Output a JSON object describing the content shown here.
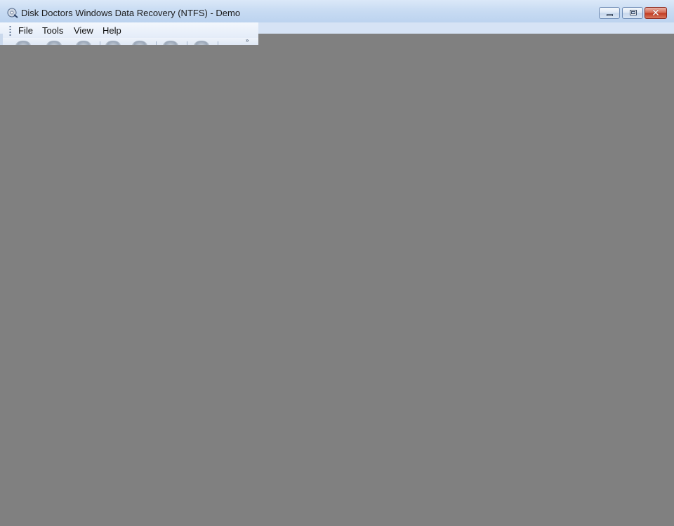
{
  "window": {
    "title": "Disk Doctors Windows Data Recovery (NTFS) - Demo",
    "app_icon": "disk-recovery-icon",
    "controls": {
      "minimize_icon": "minimize-icon",
      "maximize_icon": "restore-icon",
      "close_icon": "close-icon",
      "close_glyph": "✕"
    }
  },
  "menubar": {
    "items": [
      {
        "label": "File"
      },
      {
        "label": "Tools"
      },
      {
        "label": "View"
      },
      {
        "label": "Help"
      }
    ]
  },
  "toolbar": {
    "overflow_glyph": "»"
  },
  "colors": {
    "background": "#808080",
    "title_bar": "#c9dcf3",
    "close_button": "#c23c23"
  }
}
